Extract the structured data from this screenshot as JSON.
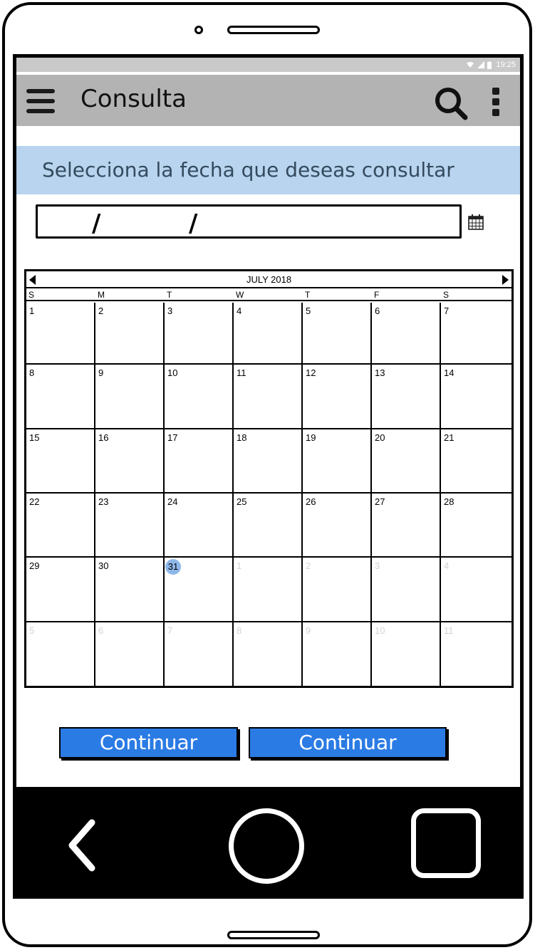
{
  "status_bar": {
    "time": "19:25",
    "icons": [
      "wifi-icon",
      "signal-icon",
      "battery-icon"
    ]
  },
  "app_bar": {
    "title": "Consulta",
    "icons": [
      "menu-icon",
      "search-icon",
      "overflow-menu-icon"
    ]
  },
  "instruction": "Selecciona la fecha que deseas consultar",
  "date_input": {
    "separator": "/",
    "icon": "calendar-icon"
  },
  "calendar": {
    "month_label": "JULY 2018",
    "weekdays": [
      "S",
      "M",
      "T",
      "W",
      "T",
      "F",
      "S"
    ],
    "weeks": [
      [
        {
          "d": "1"
        },
        {
          "d": "2"
        },
        {
          "d": "3"
        },
        {
          "d": "4"
        },
        {
          "d": "5"
        },
        {
          "d": "6"
        },
        {
          "d": "7"
        }
      ],
      [
        {
          "d": "8"
        },
        {
          "d": "9"
        },
        {
          "d": "10"
        },
        {
          "d": "11"
        },
        {
          "d": "12"
        },
        {
          "d": "13"
        },
        {
          "d": "14"
        }
      ],
      [
        {
          "d": "15"
        },
        {
          "d": "16"
        },
        {
          "d": "17"
        },
        {
          "d": "18"
        },
        {
          "d": "19"
        },
        {
          "d": "20"
        },
        {
          "d": "21"
        }
      ],
      [
        {
          "d": "22"
        },
        {
          "d": "23"
        },
        {
          "d": "24"
        },
        {
          "d": "25"
        },
        {
          "d": "26"
        },
        {
          "d": "27"
        },
        {
          "d": "28"
        }
      ],
      [
        {
          "d": "29"
        },
        {
          "d": "30"
        },
        {
          "d": "31",
          "selected": true
        },
        {
          "d": "1",
          "other": true
        },
        {
          "d": "2",
          "other": true
        },
        {
          "d": "3",
          "other": true
        },
        {
          "d": "4",
          "other": true
        }
      ],
      [
        {
          "d": "5",
          "other": true
        },
        {
          "d": "6",
          "other": true
        },
        {
          "d": "7",
          "other": true
        },
        {
          "d": "8",
          "other": true
        },
        {
          "d": "9",
          "other": true
        },
        {
          "d": "10",
          "other": true
        },
        {
          "d": "11",
          "other": true
        }
      ]
    ],
    "selected_color": "#8fb8ea"
  },
  "buttons": {
    "continue_1": "Continuar",
    "continue_2": "Continuar",
    "color": "#2b7be4"
  },
  "nav_bar": {
    "icons": [
      "back-icon",
      "home-icon",
      "recent-apps-icon"
    ]
  }
}
